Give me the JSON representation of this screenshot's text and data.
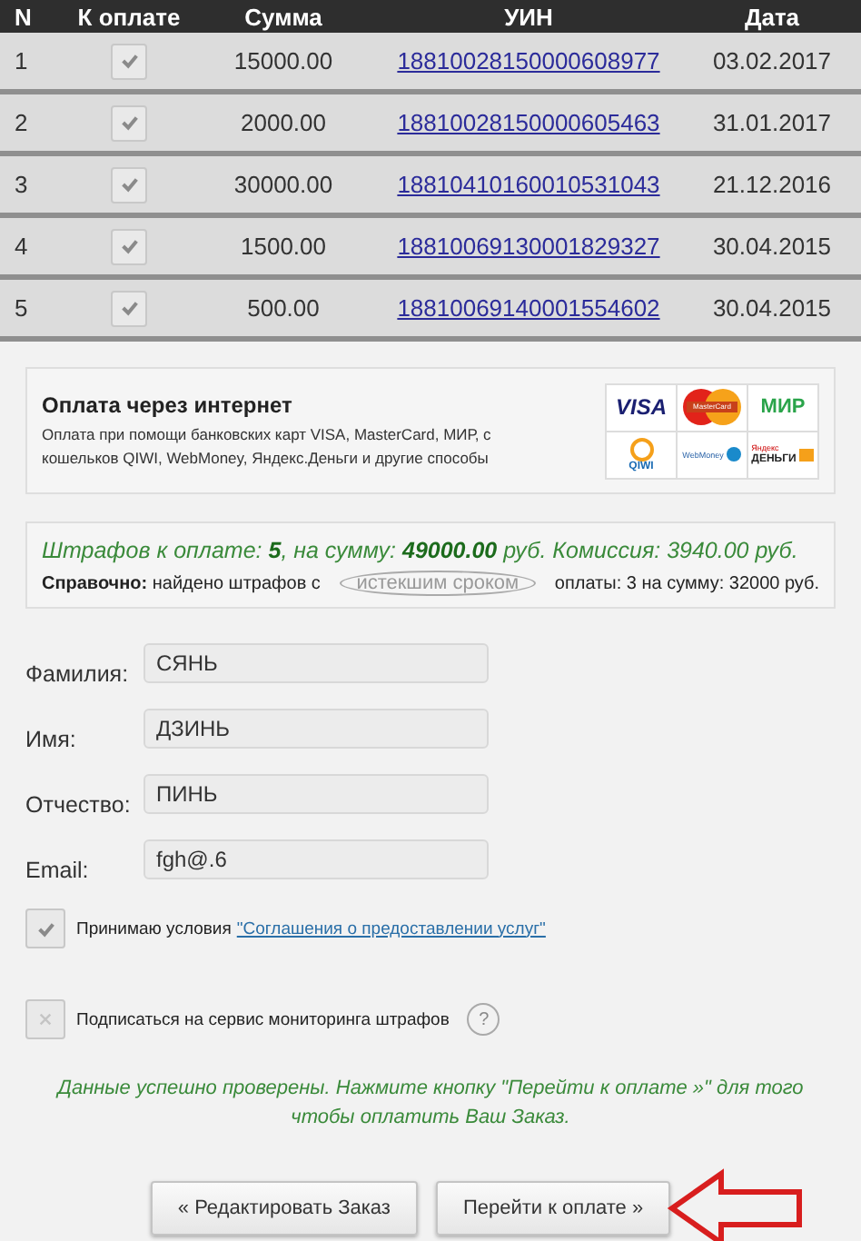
{
  "table": {
    "columns": [
      "N",
      "К оплате",
      "Сумма",
      "УИН",
      "Дата"
    ],
    "rows": [
      {
        "n": "1",
        "checked": true,
        "sum": "15000.00",
        "uin": "18810028150000608977",
        "date": "03.02.2017"
      },
      {
        "n": "2",
        "checked": true,
        "sum": "2000.00",
        "uin": "18810028150000605463",
        "date": "31.01.2017"
      },
      {
        "n": "3",
        "checked": true,
        "sum": "30000.00",
        "uin": "18810410160010531043",
        "date": "21.12.2016"
      },
      {
        "n": "4",
        "checked": true,
        "sum": "1500.00",
        "uin": "18810069130001829327",
        "date": "30.04.2015"
      },
      {
        "n": "5",
        "checked": true,
        "sum": "500.00",
        "uin": "18810069140001554602",
        "date": "30.04.2015"
      }
    ]
  },
  "payment": {
    "title": "Оплата через интернет",
    "description": "Оплата при помощи банковских карт VISA, MasterCard, МИР, с кошельков QIWI, WebMoney, Яндекс.Деньги и другие способы",
    "logos": [
      {
        "kind": "visa",
        "label": "VISA"
      },
      {
        "kind": "mastercard",
        "label": "MasterCard"
      },
      {
        "kind": "mir",
        "label": "МИР"
      },
      {
        "kind": "qiwi",
        "label": "QIWI"
      },
      {
        "kind": "webmoney",
        "label": "WebMoney"
      },
      {
        "kind": "yandex",
        "label": "Яндекс",
        "label_2": "ДЕНЬГИ"
      }
    ]
  },
  "summary": {
    "total": "Штрафов к оплате: **5**, на сумму: **49000.00** руб. Комиссия: 3940.00 руб.",
    "reference": {
      "before": "**Справочно:** найдено штрафов с",
      "circled": "истекшим сроком",
      "after": "оплаты: 3 на сумму: 32000 руб."
    }
  },
  "form": {
    "fields": [
      {
        "label": "Фамилия:",
        "value": "СЯНЬ"
      },
      {
        "label": "Имя:",
        "value": "ДЗИНЬ"
      },
      {
        "label": "Отчество:",
        "value": "ПИНЬ"
      },
      {
        "label": "Email:",
        "value": "fgh@.6"
      }
    ],
    "agree": {
      "checked": true,
      "text": "Принимаю условия",
      "link": "\"Соглашения о предоставлении услуг\""
    },
    "subscribe": {
      "checked": false,
      "text": "Подписаться на сервис мониторинга штрафов",
      "help": "?"
    }
  },
  "message": "Данные успешно проверены. Нажмите кнопку \"Перейти к оплате »\" для того чтобы оплатить Ваш Заказ.",
  "buttons": [
    "« Редактировать Заказ",
    "Перейти к оплате »"
  ]
}
